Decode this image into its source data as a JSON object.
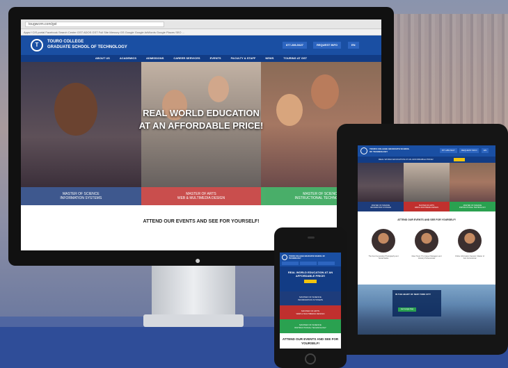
{
  "desktop": {
    "url": "tougwcrm.com/gst",
    "bookmarks": "Apps  f CIS portal  Facebook  Search Center  GST  ADOS  GST  Full Site Mercury  GS  Google  Google AdWords  Google Places  SEO  ...",
    "brand_line1": "TOURO COLLEGE",
    "brand_line2": "GRADUATE SCHOOL OF TECHNOLOGY",
    "logo_text": "T",
    "phone_btn": "877-286-5427",
    "info_btn": "REQUEST INFO",
    "lang_btn": "EN",
    "nav": [
      "ABOUT US",
      "ACADEMICS",
      "ADMISSIONS",
      "CAREER SERVICES",
      "EVENTS",
      "FACULTY & STAFF",
      "NEWS",
      "TOURING AT GST"
    ],
    "hero_line1": "REAL WORLD EDUCATION",
    "hero_line2": "AT AN AFFORDABLE PRICE!",
    "programs": [
      {
        "line1": "MASTER OF SCIENCE",
        "line2": "INFORMATION SYSTEMS"
      },
      {
        "line1": "MASTER OF ARTS",
        "line2": "WEB & MULTIMEDIA DESIGN"
      },
      {
        "line1": "MASTER OF SCIENCE",
        "line2": "INSTRUCTIONAL TECHNOLOGY"
      }
    ],
    "events_heading": "ATTEND OUR EVENTS AND SEE FOR YOURSELF!"
  },
  "tablet": {
    "brand": "TOURO COLLEGE GRADUATE SCHOOL OF TECHNOLOGY",
    "phone_btn": "877-286-5427",
    "info_btn": "REQUEST INFO",
    "lang_btn": "EN",
    "tagline": "REAL WORLD EDUCATION AT AN AFFORDABLE PRICE!",
    "programs": [
      {
        "line1": "MASTER OF SCIENCE",
        "line2": "INFORMATION SYSTEMS"
      },
      {
        "line1": "MASTER OF ARTS",
        "line2": "WEB & MULTIMEDIA DESIGN"
      },
      {
        "line1": "MASTER OF SCIENCE",
        "line2": "INSTRUCTIONAL TECHNOLOGY"
      }
    ],
    "events_heading": "ATTEND OUR EVENTS AND SEE FOR YOURSELF!",
    "captions": [
      "The Next Generation Photography and Social Media",
      "Meet Touro: Pro Career Managers and Industry Professionals",
      "Online Information Session: Master of Arts Instructional"
    ],
    "city_title": "IN THE HEART OF NEW YORK CITY",
    "city_btn": "Get Google Map"
  },
  "phone": {
    "brand": "TOURO COLLEGE GRADUATE SCHOOL OF TECHNOLOGY",
    "tagline": "REAL WORLD EDUCATION AT AN AFFORDABLE PRICE!",
    "programs": [
      {
        "line1": "MASTER OF SCIENCE",
        "line2": "INFORMATION SYSTEMS"
      },
      {
        "line1": "MASTER OF ARTS",
        "line2": "WEB & MULTIMEDIA DESIGN"
      },
      {
        "line1": "MASTER OF SCIENCE",
        "line2": "INSTRUCTIONAL TECHNOLOGY"
      }
    ],
    "events_heading": "ATTEND OUR EVENTS AND SEE FOR YOURSELF!"
  },
  "colors": {
    "brand_blue": "#1a4fa3",
    "nav_blue": "#123c85",
    "red": "#c0302e",
    "green": "#2aa150",
    "yellow": "#f1c40f"
  },
  "icons": [
    "apple-logo-icon",
    "touro-logo-icon",
    "home-button-icon"
  ]
}
